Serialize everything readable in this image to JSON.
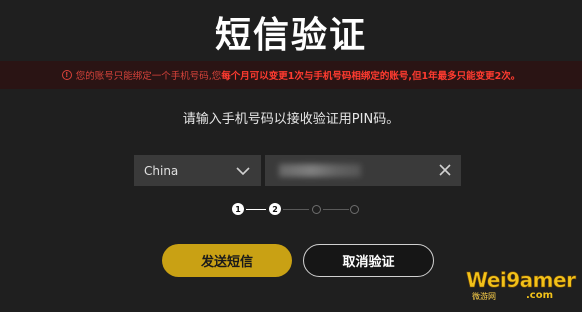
{
  "title": "短信验证",
  "warning": {
    "icon": "alert-circle-icon",
    "text_normal": "您的账号只能绑定一个手机号码,您",
    "text_bold": "每个月可以变更1次与手机号码相绑定的账号,但1年最多只能变更2次。",
    "color": "#d8433b"
  },
  "prompt": "请输入手机号码以接收验证用PIN码。",
  "country_select": {
    "value": "China",
    "icon": "chevron-down-icon"
  },
  "phone_input": {
    "value": "",
    "clear_icon": "close-icon"
  },
  "steps": {
    "items": [
      "1",
      "2",
      "",
      ""
    ],
    "current": 2
  },
  "buttons": {
    "send": "发送短信",
    "cancel": "取消验证"
  },
  "watermark": {
    "text": "Wei9amer",
    "sub": "微游网",
    "domain": ".com"
  },
  "colors": {
    "accent": "#c9a114",
    "background": "#1f1f1f",
    "warning": "#ff3b30"
  }
}
